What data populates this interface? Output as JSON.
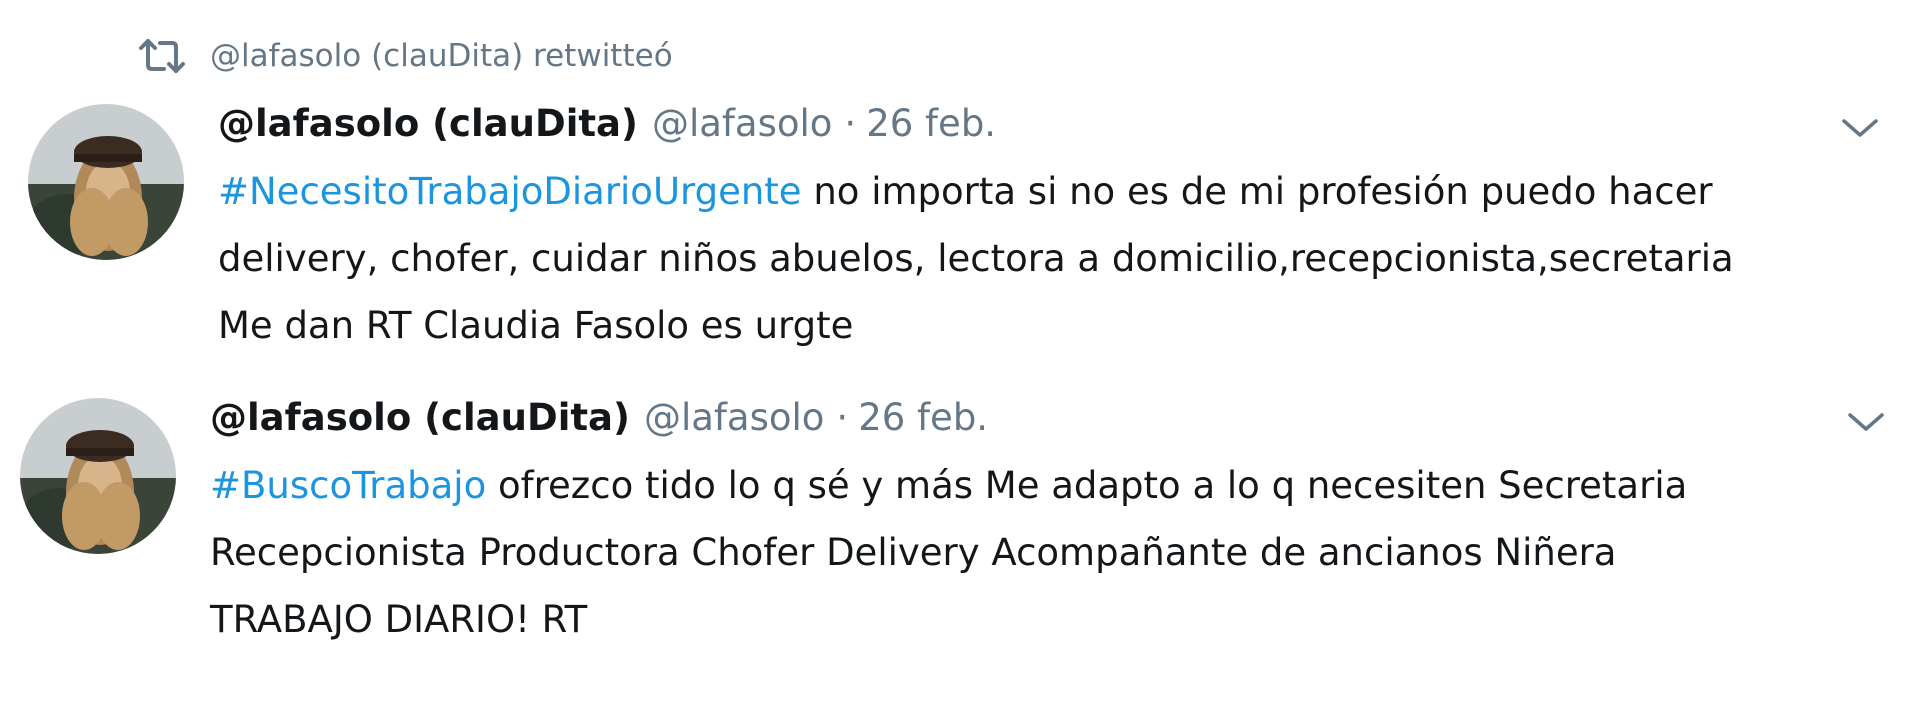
{
  "retweet": {
    "icon": "retweet-icon",
    "text": "@lafasolo (clauDita) retwitteó"
  },
  "tweets": [
    {
      "display_name": "@lafasolo (clauDita)",
      "handle": "@lafasolo",
      "separator": "·",
      "date": "26 feb.",
      "hashtag": "#NecesitoTrabajoDiarioUrgente",
      "line1_rest": " no importa si no es de mi profesión puedo hacer",
      "line2": "delivery, chofer, cuidar niños abuelos, lectora a domicilio,recepcionista,secretaria",
      "line3": "Me dan RT Claudia Fasolo es urgte"
    },
    {
      "display_name": "@lafasolo (clauDita)",
      "handle": "@lafasolo",
      "separator": "·",
      "date": "26 feb.",
      "hashtag": "#BuscoTrabajo",
      "line1_rest": " ofrezco tido lo q sé y más Me adapto a lo q necesiten Secretaria",
      "line2": "Recepcionista Productora Chofer Delivery Acompañante de ancianos Niñera",
      "line3": "TRABAJO DIARIO! RT"
    }
  ],
  "colors": {
    "secondary_text": "#657786",
    "hashtag": "#1b95e0",
    "primary_text": "#14171a"
  }
}
